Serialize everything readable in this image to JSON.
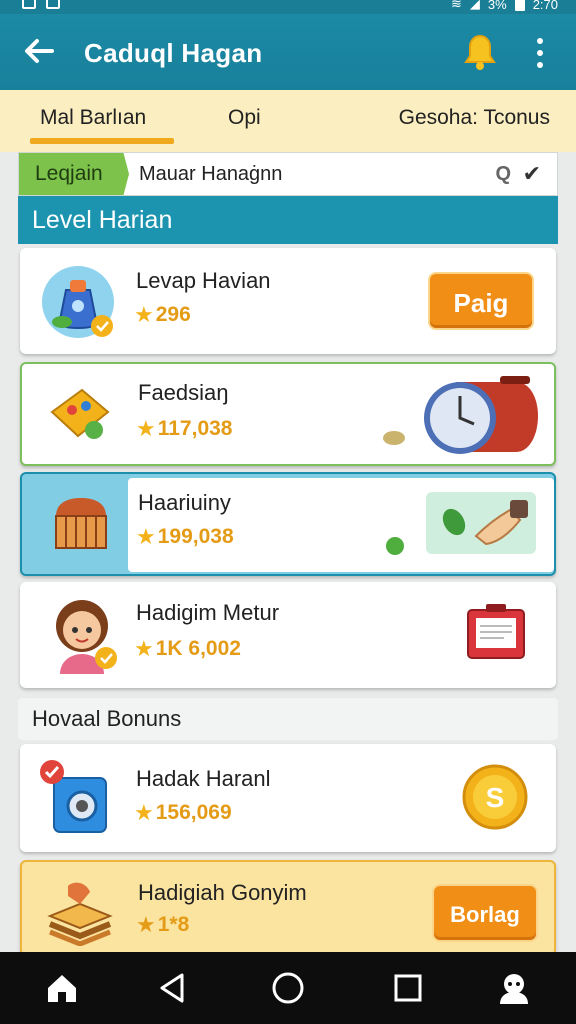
{
  "status": {
    "time": "2:70",
    "battery": "3%"
  },
  "appbar": {
    "title": "Caduql Hagan",
    "icons": [
      "back-arrow-icon",
      "bell-icon",
      "more-vert-icon"
    ]
  },
  "tabs": [
    {
      "label": "Mal Barlıan",
      "active": true
    },
    {
      "label": "Opi",
      "active": false
    },
    {
      "label": "Gesoha: Tconus",
      "active": false
    }
  ],
  "search": {
    "chip": "Leqjain",
    "value": "Mauar Hanaġnn",
    "q_label": "Q"
  },
  "sections": {
    "level": "Level Harian",
    "bonus": "Hovaal Bonuns"
  },
  "cards": [
    {
      "name": "Levap Havian",
      "points": "296",
      "icon": "potion-bag-icon",
      "action": "Paig"
    },
    {
      "name": "Faedsiaŋ",
      "points": "117,038",
      "icon": "map-board-icon",
      "extra_icon": "wall-clock-icon"
    },
    {
      "name": "Haariuiny",
      "points": "199,038",
      "icon": "treasure-chest-icon",
      "extra_icon": "hand-leaf-icon"
    },
    {
      "name": "Hadigim Metur",
      "points": "1K 6,002",
      "icon": "girl-avatar-icon",
      "extra_icon": "gift-box-icon"
    }
  ],
  "bonus_cards": [
    {
      "name": "Hadak Haranl",
      "points": "156,069",
      "icon": "camera-bag-icon",
      "extra_icon": "gold-coin-icon"
    },
    {
      "name": "Hadigiah Gonyim",
      "points": "1*8",
      "icon": "food-stack-icon",
      "action": "Borlag"
    }
  ],
  "colors": {
    "primary": "#1a86a0",
    "accent": "#f08e16",
    "tab_bg": "#fbeec0",
    "chip": "#7cc24b"
  }
}
